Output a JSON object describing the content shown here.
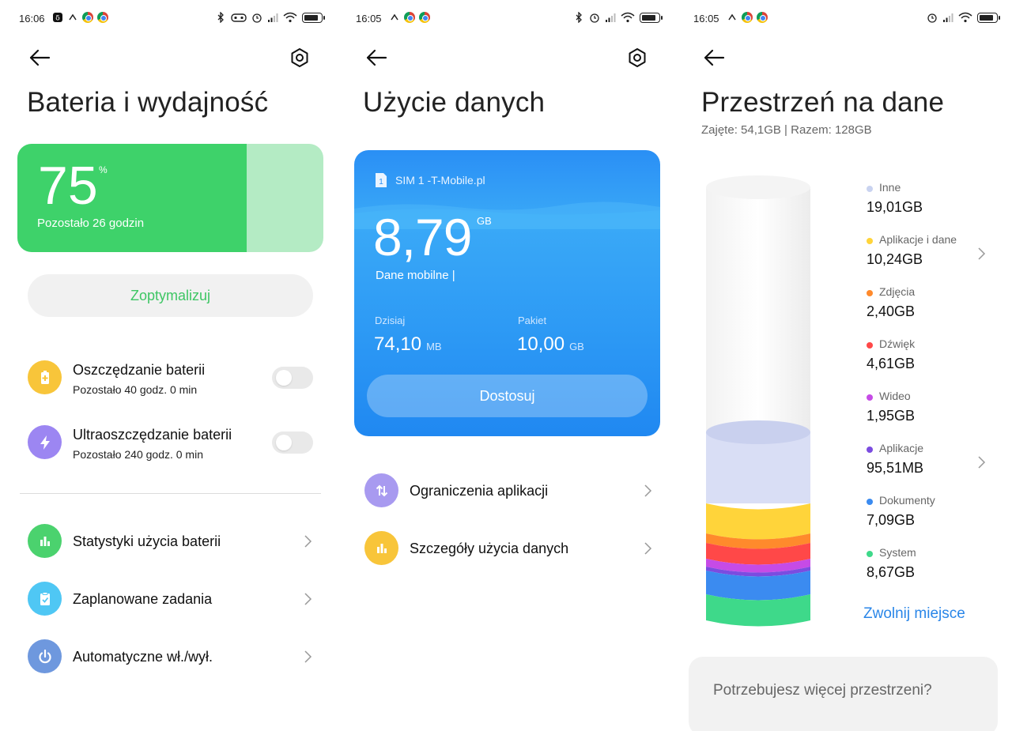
{
  "colors": {
    "battery_green": "#3ED26A",
    "battery_green_light": "#B4EBC4",
    "optimize_text": "#3EC664",
    "data_blue": "#2A8FF5",
    "link_blue": "#2A86E8"
  },
  "panel_battery": {
    "status_time": "16:06",
    "title": "Bateria i wydajność",
    "battery_level_fraction": 0.75,
    "percent": "75",
    "percent_sign": "%",
    "remaining": "Pozostało 26 godzin",
    "optimize_label": "Zoptymalizuj",
    "modes": [
      {
        "label": "Oszczędzanie baterii",
        "sub": "Pozostało 40 godz. 0 min",
        "icon": "battery-saver-icon",
        "color": "#F8C53A",
        "enabled": false
      },
      {
        "label": "Ultraoszczędzanie baterii",
        "sub": "Pozostało 240 godz. 0 min",
        "icon": "lightning-icon",
        "color": "#9C86F2",
        "enabled": false
      }
    ],
    "links": [
      {
        "label": "Statystyki użycia baterii",
        "icon": "bar-chart-icon",
        "color": "#4BD26E"
      },
      {
        "label": "Zaplanowane zadania",
        "icon": "clipboard-check-icon",
        "color": "#4FC7F4"
      },
      {
        "label": "Automatyczne wł./wył.",
        "icon": "power-icon",
        "color": "#6E98DE"
      }
    ]
  },
  "panel_data": {
    "status_time": "16:05",
    "title": "Użycie danych",
    "sim_label": "SIM 1 -T-Mobile.pl",
    "sim_number": "1",
    "usage_value": "8,79",
    "usage_unit": "GB",
    "data_type": "Dane mobilne |",
    "today_label": "Dzisiaj",
    "today_value": "74,10",
    "today_unit": "MB",
    "plan_label": "Pakiet",
    "plan_value": "10,00",
    "plan_unit": "GB",
    "adjust_label": "Dostosuj",
    "links": [
      {
        "label": "Ograniczenia aplikacji",
        "icon": "up-down-arrows-icon",
        "color": "#A89AF0"
      },
      {
        "label": "Szczegóły użycia danych",
        "icon": "bar-chart-icon",
        "color": "#F8C53A"
      }
    ]
  },
  "panel_storage": {
    "status_time": "16:05",
    "title": "Przestrzeń na dane",
    "subtitle": "Zajęte: 54,1GB | Razem: 128GB",
    "legend": [
      {
        "name": "Inne",
        "value": "19,01GB",
        "color": "#C9D3F0",
        "chevron": false
      },
      {
        "name": "Aplikacje i dane",
        "value": "10,24GB",
        "color": "#FFD43A",
        "chevron": true
      },
      {
        "name": "Zdjęcia",
        "value": "2,40GB",
        "color": "#FF8A2C",
        "chevron": false
      },
      {
        "name": "Dźwięk",
        "value": "4,61GB",
        "color": "#FF4848",
        "chevron": false
      },
      {
        "name": "Wideo",
        "value": "1,95GB",
        "color": "#C64BE6",
        "chevron": false
      },
      {
        "name": "Aplikacje",
        "value": "95,51MB",
        "color": "#7B4CE0",
        "chevron": true
      },
      {
        "name": "Dokumenty",
        "value": "7,09GB",
        "color": "#3B8BF0",
        "chevron": false
      },
      {
        "name": "System",
        "value": "8,67GB",
        "color": "#3ED98A",
        "chevron": false
      }
    ],
    "free_up_label": "Zwolnij miejsce",
    "more_space_label": "Potrzebujesz więcej przestrzeni?"
  }
}
